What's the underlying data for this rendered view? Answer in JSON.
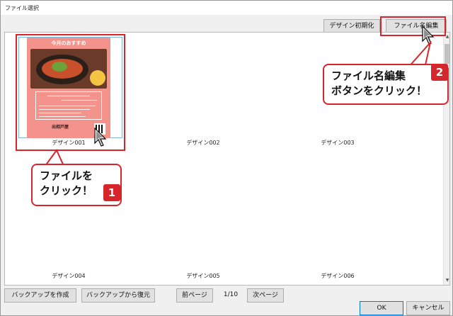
{
  "window": {
    "title": "ファイル選択"
  },
  "toolbar": {
    "reset_label": "デザイン初期化",
    "rename_label": "ファイル名編集"
  },
  "designs": {
    "items": [
      {
        "label": "デザイン001"
      },
      {
        "label": "デザイン002"
      },
      {
        "label": "デザイン003"
      },
      {
        "label": "デザイン004"
      },
      {
        "label": "デザイン005"
      },
      {
        "label": "デザイン006"
      }
    ]
  },
  "poster": {
    "title": "今月のおすすめ",
    "footer": "出相戸屋"
  },
  "footer": {
    "backup_label": "バックアップを作成",
    "restore_label": "バックアップから復元",
    "prev_label": "前ページ",
    "page_indicator": "1/10",
    "next_label": "次ページ",
    "ok_label": "OK",
    "cancel_label": "キャンセル"
  },
  "callouts": {
    "file": {
      "line1": "ファイルを",
      "line2": "クリック！",
      "number": "1"
    },
    "rename": {
      "line1": "ファイル名編集",
      "line2": "ボタンをクリック！",
      "number": "2"
    }
  },
  "colors": {
    "accent": "#d7262b",
    "selection": "#7fb7e3",
    "poster": "#f3938c",
    "default_border": "#0078d7"
  }
}
